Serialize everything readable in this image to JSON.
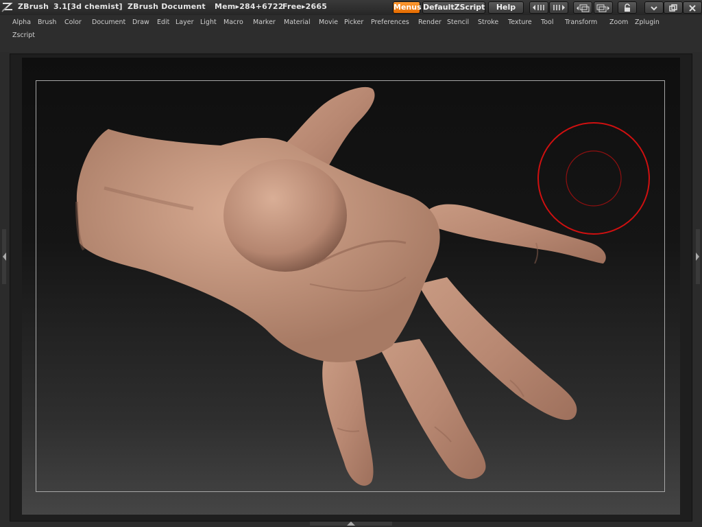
{
  "titlebar": {
    "app": "ZBrush",
    "version": "3.1[3d chemist]",
    "document": "ZBrush Document",
    "mem": "Mem▸284+6722",
    "free": "Free▸2665",
    "buttons": {
      "menus": "Menus",
      "script": "DefaultZScript",
      "help": "Help"
    },
    "accent_color": "#f07800"
  },
  "menus": {
    "row1": [
      "Alpha",
      "Brush",
      "Color",
      "Document",
      "Draw",
      "Edit",
      "Layer",
      "Light",
      "Macro",
      "Marker",
      "Material",
      "Movie",
      "Picker",
      "Preferences",
      "Render",
      "Stencil",
      "Stroke",
      "Texture",
      "Tool",
      "Transform",
      "Zoom",
      "Zplugin"
    ],
    "row2": [
      "Zscript"
    ]
  },
  "canvas": {
    "subject": "hand-sculpt",
    "brush_outer_color": "#d01010",
    "brush_inner_color": "#901010"
  }
}
